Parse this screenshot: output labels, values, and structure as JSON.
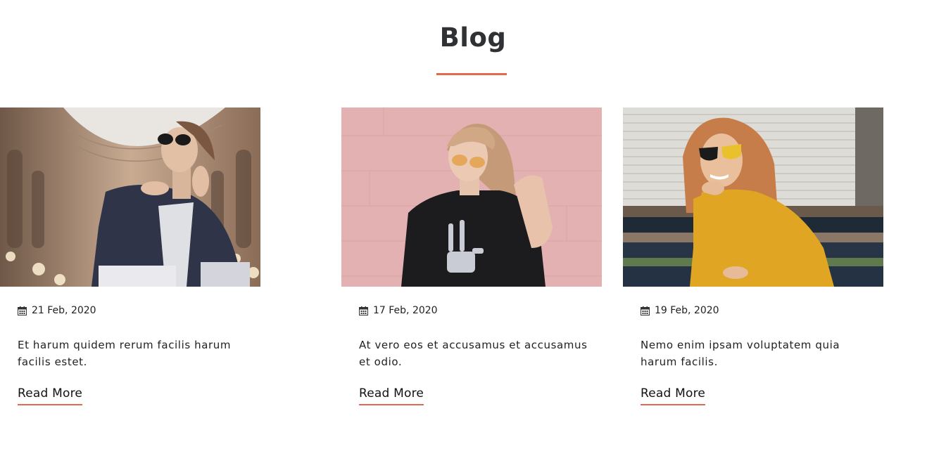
{
  "section": {
    "title": "Blog",
    "accent_color": "#e06a4a"
  },
  "posts": [
    {
      "date": "17 Feb, 2020",
      "excerpt": "At vero eos et accusamus et accusamus et odio.",
      "read_more": "Read More",
      "image": "woman-pink-wall-skeleton-tshirt"
    },
    {
      "date": "19 Feb, 2020",
      "excerpt": "Nemo enim ipsam voluptatem quia harum facilis.",
      "read_more": "Read More",
      "image": "woman-yellow-sweater-stairs"
    },
    {
      "date": "21 Feb, 2020",
      "excerpt": "Et harum quidem rerum facilis harum facilis estet.",
      "read_more": "Read More",
      "image": "woman-sunglasses-shopping-gallery"
    }
  ]
}
